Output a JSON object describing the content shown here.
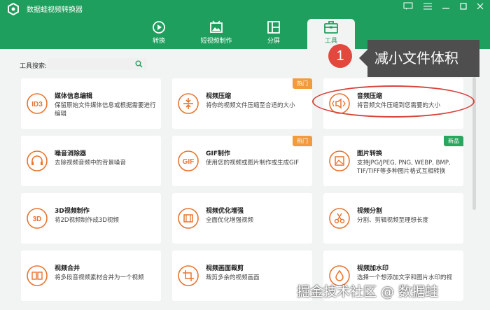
{
  "app": {
    "title": "数据蛙视频转换器"
  },
  "nav": {
    "tabs": [
      {
        "label": "转换",
        "icon": "convert-icon"
      },
      {
        "label": "短视频制作",
        "icon": "short-video-icon"
      },
      {
        "label": "分屏",
        "icon": "split-screen-icon"
      },
      {
        "label": "工具",
        "icon": "toolbox-icon",
        "active": true
      }
    ]
  },
  "search": {
    "label": "工具搜索:",
    "placeholder": ""
  },
  "tools": [
    {
      "title": "媒体信息编辑",
      "desc": "保留原始文件媒体信息或根据需要进行编辑",
      "icon": "id3-icon",
      "badge": ""
    },
    {
      "title": "视频压缩",
      "desc": "将你的视频文件压缩至合适的大小",
      "icon": "video-compress-icon",
      "badge": "热门"
    },
    {
      "title": "音频压缩",
      "desc": "将音频文件压缩到您需要的大小",
      "icon": "audio-compress-icon",
      "badge": ""
    },
    {
      "title": "噪音消除器",
      "desc": "去除视频音频中的背景噪音",
      "icon": "headphones-icon",
      "badge": ""
    },
    {
      "title": "GIF制作",
      "desc": "使用您的视频或图片制作或生成GIF",
      "icon": "gif-icon",
      "badge": "热门"
    },
    {
      "title": "图片转换",
      "desc": "支持JPG/JPEG, PNG, WEBP, BMP, TIF/TIFF等多种图片格式互相转换",
      "icon": "image-convert-icon",
      "badge": "新品"
    },
    {
      "title": "3D视频制作",
      "desc": "将2D视频制作成3D视频",
      "icon": "3d-icon",
      "badge": ""
    },
    {
      "title": "视频优化增强",
      "desc": "全面优化增强视频",
      "icon": "video-enhance-icon",
      "badge": ""
    },
    {
      "title": "视频分割",
      "desc": "分割、剪辑视频至理想长度",
      "icon": "scissors-icon",
      "badge": ""
    },
    {
      "title": "视频合并",
      "desc": "将多段音视频素材合并为一个视频",
      "icon": "merge-icon",
      "badge": ""
    },
    {
      "title": "视频画面裁剪",
      "desc": "裁剪多余的视频画面",
      "icon": "crop-icon",
      "badge": ""
    },
    {
      "title": "视频加水印",
      "desc": "选择一个想添加文字和图片水印的视",
      "icon": "watermark-drop-icon",
      "badge": ""
    }
  ],
  "annotation": {
    "step": "1",
    "callout": "减小文件体积"
  },
  "watermark": "掘金技术社区 @ 数据蛙",
  "colors": {
    "brand": "#1f9f5d",
    "accent_icon": "#e8742f",
    "hot_badge": "#f19b3c",
    "new_badge": "#2aa65f",
    "annotation_red": "#d8443d",
    "callout_bg": "#4e4e4e"
  }
}
